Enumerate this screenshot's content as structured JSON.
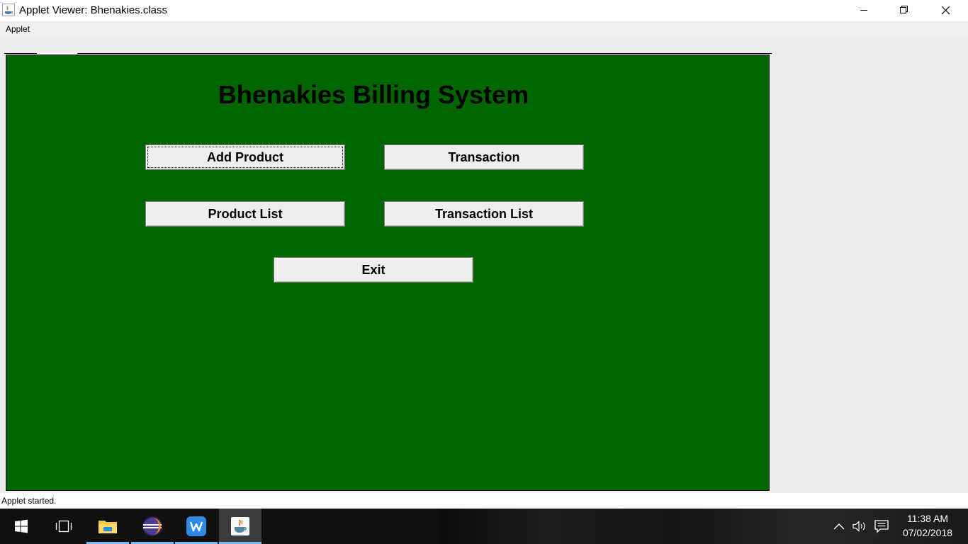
{
  "window": {
    "title": "Applet Viewer: Bhenakies.class",
    "app_icon": "java-icon",
    "controls": [
      "minimize-icon",
      "restore-icon",
      "close-icon"
    ]
  },
  "menubar": {
    "items": [
      {
        "label": "Applet"
      }
    ]
  },
  "applet": {
    "heading": "Bhenakies Billing System",
    "background_color": "#016600",
    "buttons": {
      "add_product": "Add Product",
      "transaction": "Transaction",
      "product_list": "Product List",
      "transaction_list": "Transaction List",
      "exit": "Exit"
    }
  },
  "status": {
    "text": "Applet started."
  },
  "taskbar": {
    "items": [
      "windows-start-icon",
      "task-view-icon",
      "file-explorer-icon",
      "eclipse-icon",
      "wps-writer-icon",
      "java-icon"
    ],
    "active_item": "java-icon",
    "accent_color": "#76b9ed",
    "tray_icons": [
      "chevron-up-icon",
      "speaker-icon",
      "notification-icon"
    ],
    "time": "11:38 AM",
    "date": "07/02/2018"
  }
}
